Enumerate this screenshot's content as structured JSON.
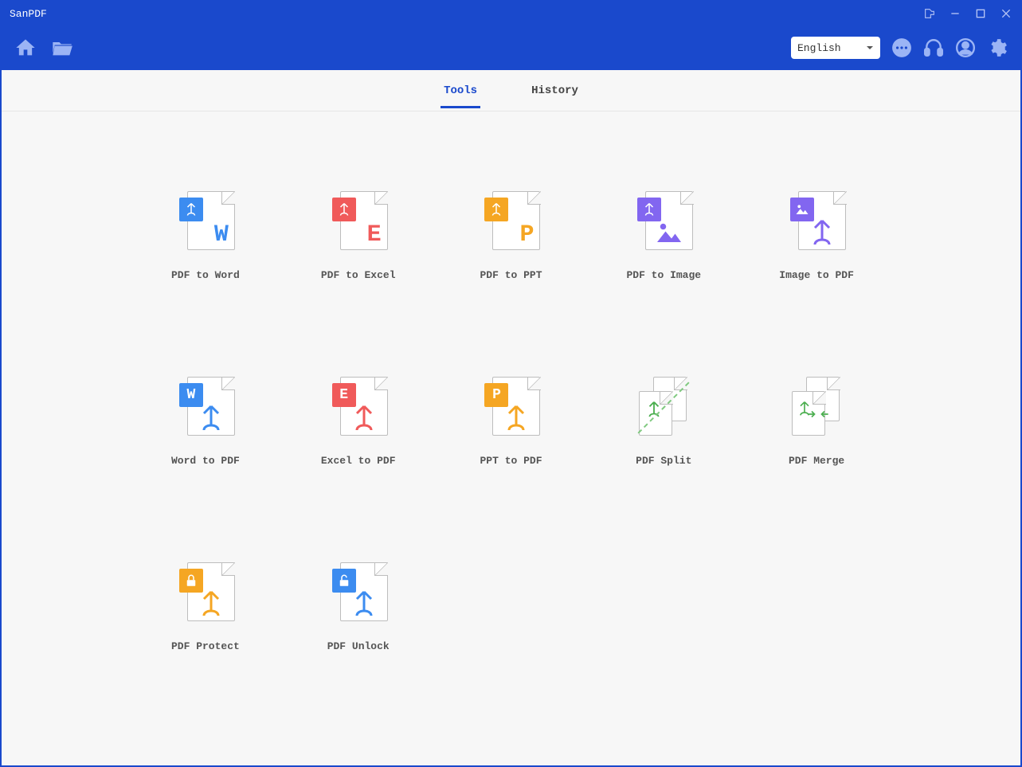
{
  "app": {
    "title": "SanPDF"
  },
  "toolbar": {
    "language": "English"
  },
  "tabs": {
    "tools": "Tools",
    "history": "History",
    "active": "tools"
  },
  "tools": [
    {
      "id": "pdf-to-word",
      "label": "PDF to Word"
    },
    {
      "id": "pdf-to-excel",
      "label": "PDF to Excel"
    },
    {
      "id": "pdf-to-ppt",
      "label": "PDF to PPT"
    },
    {
      "id": "pdf-to-image",
      "label": "PDF to Image"
    },
    {
      "id": "image-to-pdf",
      "label": "Image to PDF"
    },
    {
      "id": "word-to-pdf",
      "label": "Word to PDF"
    },
    {
      "id": "excel-to-pdf",
      "label": "Excel to PDF"
    },
    {
      "id": "ppt-to-pdf",
      "label": "PPT to PDF"
    },
    {
      "id": "pdf-split",
      "label": "PDF Split"
    },
    {
      "id": "pdf-merge",
      "label": "PDF Merge"
    },
    {
      "id": "pdf-protect",
      "label": "PDF Protect"
    },
    {
      "id": "pdf-unlock",
      "label": "PDF Unlock"
    }
  ]
}
